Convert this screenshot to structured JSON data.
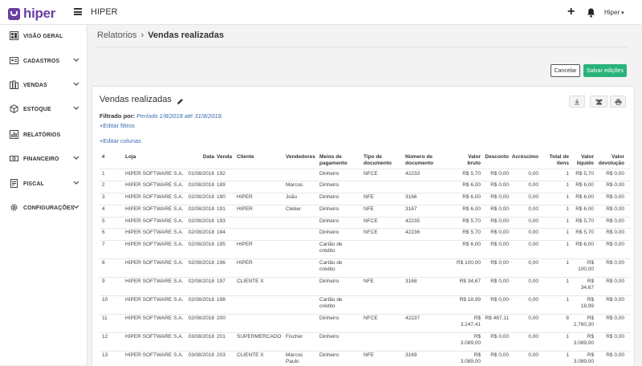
{
  "topbar": {
    "logo_text": "hiper",
    "app_title": "HIPER",
    "plus_label": "+",
    "user_label": "Hiper"
  },
  "sidebar": {
    "items": [
      {
        "label": "VISÃO GERAL",
        "icon": "dashboard-icon",
        "expandable": false
      },
      {
        "label": "CADASTROS",
        "icon": "id-card-icon",
        "expandable": true
      },
      {
        "label": "VENDAS",
        "icon": "books-icon",
        "expandable": true
      },
      {
        "label": "ESTOQUE",
        "icon": "box-icon",
        "expandable": true
      },
      {
        "label": "RELATÓRIOS",
        "icon": "bar-chart-icon",
        "expandable": false
      },
      {
        "label": "FINANCEIRO",
        "icon": "money-icon",
        "expandable": true
      },
      {
        "label": "FISCAL",
        "icon": "document-icon",
        "expandable": true
      },
      {
        "label": "CONFIGURAÇÕES",
        "icon": "gear-icon",
        "expandable": true
      }
    ]
  },
  "breadcrumb": {
    "parent": "Relatorios",
    "separator": "›",
    "current": "Vendas realizadas"
  },
  "actions": {
    "cancel_label": "Cancelar",
    "save_label": "Salvar edições"
  },
  "card": {
    "title": "Vendas realizadas",
    "filter_label": "Filtrado por:",
    "filter_value": "Período 1/8/2018 até 31/8/2018.",
    "edit_filters": "+Editar filtros",
    "edit_columns": "+Editar colunas"
  },
  "colors": {
    "brand": "#6b3fa0",
    "save_button": "#2ab27b",
    "link": "#3a6db0"
  },
  "table": {
    "columns": [
      [
        "#"
      ],
      [
        "Loja"
      ],
      [
        "Data"
      ],
      [
        "Venda"
      ],
      [
        "Cliente"
      ],
      [
        "Vendedores"
      ],
      [
        "Meios de",
        "pagamento"
      ],
      [
        "Tipo de",
        "documento"
      ],
      [
        "Número de",
        "documento"
      ],
      [
        "Valor",
        "bruto"
      ],
      [
        "Desconto"
      ],
      [
        "Acréscimo"
      ],
      [
        "Total de",
        "itens"
      ],
      [
        "Valor",
        "líquido"
      ],
      [
        "Valor",
        "devolução"
      ]
    ],
    "rows": [
      {
        "n": "1",
        "loja": "HIPER SOFTWARE S.A.",
        "data": "01/08/2018",
        "venda": "192",
        "cliente": "",
        "vend": [],
        "meio": [
          "Dinheiro"
        ],
        "tipo": "NFCE",
        "numdoc": "42233",
        "bruto": [
          "R$ 5,70"
        ],
        "desc": "R$ 0,00",
        "acr": "0,00",
        "itens": "1",
        "liq": [
          "R$ 5,70"
        ],
        "dev": "R$ 0,00"
      },
      {
        "n": "2",
        "loja": "HIPER SOFTWARE S.A.",
        "data": "02/08/2018",
        "venda": "189",
        "cliente": "",
        "vend": [
          "Marcos"
        ],
        "meio": [
          "Dinheiro"
        ],
        "tipo": "",
        "numdoc": "",
        "bruto": [
          "R$ 6,00"
        ],
        "desc": "R$ 0,00",
        "acr": "0,00",
        "itens": "1",
        "liq": [
          "R$ 6,00"
        ],
        "dev": "R$ 0,00"
      },
      {
        "n": "3",
        "loja": "HIPER SOFTWARE S.A.",
        "data": "02/08/2018",
        "venda": "190",
        "cliente": "HIPER",
        "vend": [
          "João"
        ],
        "meio": [
          "Dinheiro"
        ],
        "tipo": "NFE",
        "numdoc": "3166",
        "bruto": [
          "R$ 6,00"
        ],
        "desc": "R$ 0,00",
        "acr": "0,00",
        "itens": "1",
        "liq": [
          "R$ 6,00"
        ],
        "dev": "R$ 0,00"
      },
      {
        "n": "4",
        "loja": "HIPER SOFTWARE S.A.",
        "data": "02/08/2018",
        "venda": "191",
        "cliente": "HIPER",
        "vend": [
          "Cleber"
        ],
        "meio": [
          "Dinheiro"
        ],
        "tipo": "NFE",
        "numdoc": "3167",
        "bruto": [
          "R$ 6,00"
        ],
        "desc": "R$ 0,00",
        "acr": "0,00",
        "itens": "1",
        "liq": [
          "R$ 6,00"
        ],
        "dev": "R$ 0,00"
      },
      {
        "n": "5",
        "loja": "HIPER SOFTWARE S.A.",
        "data": "02/08/2018",
        "venda": "193",
        "cliente": "",
        "vend": [],
        "meio": [
          "Dinheiro"
        ],
        "tipo": "NFCE",
        "numdoc": "42235",
        "bruto": [
          "R$ 5,70"
        ],
        "desc": "R$ 0,00",
        "acr": "0,00",
        "itens": "1",
        "liq": [
          "R$ 5,70"
        ],
        "dev": "R$ 0,00"
      },
      {
        "n": "6",
        "loja": "HIPER SOFTWARE S.A.",
        "data": "02/08/2018",
        "venda": "194",
        "cliente": "",
        "vend": [],
        "meio": [
          "Dinheiro"
        ],
        "tipo": "NFCE",
        "numdoc": "42236",
        "bruto": [
          "R$ 5,70"
        ],
        "desc": "R$ 0,00",
        "acr": "0,00",
        "itens": "1",
        "liq": [
          "R$ 5,70"
        ],
        "dev": "R$ 0,00"
      },
      {
        "n": "7",
        "loja": "HIPER SOFTWARE S.A.",
        "data": "02/08/2018",
        "venda": "195",
        "cliente": "HIPER",
        "vend": [],
        "meio": [
          "Cartão de",
          "crédito"
        ],
        "tipo": "",
        "numdoc": "",
        "bruto": [
          "R$ 6,00"
        ],
        "desc": "R$ 0,00",
        "acr": "0,00",
        "itens": "1",
        "liq": [
          "R$ 6,00"
        ],
        "dev": "R$ 0,00"
      },
      {
        "n": "8",
        "loja": "HIPER SOFTWARE S.A.",
        "data": "02/08/2018",
        "venda": "196",
        "cliente": "HIPER",
        "vend": [],
        "meio": [
          "Cartão de",
          "crédito"
        ],
        "tipo": "",
        "numdoc": "",
        "bruto": [
          "R$ 100,00"
        ],
        "desc": "R$ 0,00",
        "acr": "0,00",
        "itens": "1",
        "liq": [
          "R$",
          "100,00"
        ],
        "dev": "R$ 0,00"
      },
      {
        "n": "9",
        "loja": "HIPER SOFTWARE S.A.",
        "data": "02/08/2018",
        "venda": "197",
        "cliente": "CLIENTE X",
        "vend": [],
        "meio": [
          "Dinheiro"
        ],
        "tipo": "NFE",
        "numdoc": "3168",
        "bruto": [
          "R$ 34,67"
        ],
        "desc": "R$ 0,00",
        "acr": "0,00",
        "itens": "1",
        "liq": [
          "R$",
          "34,67"
        ],
        "dev": "R$ 0,00"
      },
      {
        "n": "10",
        "loja": "HIPER SOFTWARE S.A.",
        "data": "02/08/2018",
        "venda": "198",
        "cliente": "",
        "vend": [],
        "meio": [
          "Cartão de",
          "crédito"
        ],
        "tipo": "",
        "numdoc": "",
        "bruto": [
          "R$ 18,99"
        ],
        "desc": "R$ 0,00",
        "acr": "0,00",
        "itens": "1",
        "liq": [
          "R$",
          "18,99"
        ],
        "dev": "R$ 0,00"
      },
      {
        "n": "11",
        "loja": "HIPER SOFTWARE S.A.",
        "data": "02/08/2018",
        "venda": "200",
        "cliente": "",
        "vend": [],
        "meio": [
          "Dinheiro"
        ],
        "tipo": "NFCE",
        "numdoc": "42237",
        "bruto": [
          "R$",
          "3.247,41"
        ],
        "desc": "R$ 487,11",
        "acr": "0,00",
        "itens": "8",
        "liq": [
          "R$",
          "2.760,30"
        ],
        "dev": "R$ 0,00"
      },
      {
        "n": "12",
        "loja": "HIPER SOFTWARE S.A.",
        "data": "03/08/2018",
        "venda": "201",
        "cliente": "SUPERMERCADO",
        "vend": [
          "Fischer"
        ],
        "meio": [
          "Dinheiro"
        ],
        "tipo": "",
        "numdoc": "",
        "bruto": [
          "R$",
          "3.089,00"
        ],
        "desc": "R$ 0,00",
        "acr": "0,00",
        "itens": "1",
        "liq": [
          "R$",
          "3.089,00"
        ],
        "dev": "R$ 0,00"
      },
      {
        "n": "13",
        "loja": "HIPER SOFTWARE S.A.",
        "data": "03/08/2018",
        "venda": "203",
        "cliente": "CLIENTE X",
        "vend": [
          "Marcos",
          "Paulo"
        ],
        "meio": [
          "Dinheiro"
        ],
        "tipo": "NFE",
        "numdoc": "3169",
        "bruto": [
          "R$",
          "3.089,00"
        ],
        "desc": "R$ 0,00",
        "acr": "0,00",
        "itens": "1",
        "liq": [
          "R$",
          "3.089,00"
        ],
        "dev": "R$ 0,00"
      }
    ]
  }
}
